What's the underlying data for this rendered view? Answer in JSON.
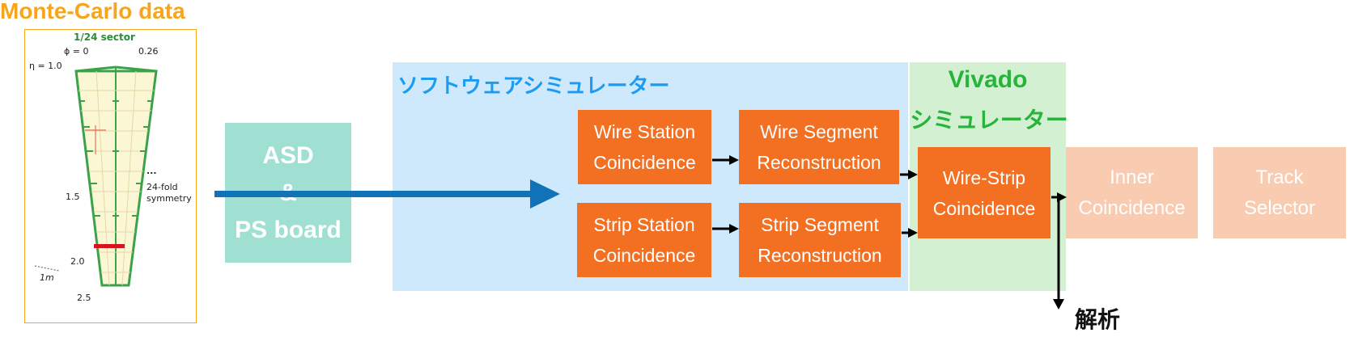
{
  "monte_carlo": {
    "title": "Monte-Carlo data",
    "sector_label": "1/24 sector",
    "phi_label": "ϕ = 0",
    "phi_max": "0.26",
    "eta_top": "η = 1.0",
    "eta_mid": "1.5",
    "eta_low": "2.0",
    "eta_bottom": "2.5",
    "dots": "...",
    "symmetry_line1": "24-fold",
    "symmetry_line2": "symmetry",
    "scale_label": "1m"
  },
  "asd_board": {
    "line1": "ASD",
    "line2": "&",
    "line3": "PS board"
  },
  "software_sim": {
    "label": "ソフトウェアシミュレーター"
  },
  "vivado_sim": {
    "label1": "Vivado",
    "label2": "シミュレーター"
  },
  "blocks": {
    "wire_station": {
      "line1": "Wire Station",
      "line2": "Coincidence"
    },
    "wire_segment": {
      "line1": "Wire Segment",
      "line2": "Reconstruction"
    },
    "strip_station": {
      "line1": "Strip Station",
      "line2": "Coincidence"
    },
    "strip_segment": {
      "line1": "Strip Segment",
      "line2": "Reconstruction"
    },
    "wire_strip": {
      "line1": "Wire-Strip",
      "line2": "Coincidence"
    },
    "inner": {
      "line1": "Inner",
      "line2": "Coincidence"
    },
    "track": {
      "line1": "Track",
      "line2": "Selector"
    }
  },
  "analysis_label": "解析",
  "colors": {
    "orange_block": "#f36f21",
    "faded_block": "#f9cbb0",
    "software_bg": "#cde9fb",
    "software_text": "#1d9bf0",
    "vivado_bg": "#d3f1d2",
    "vivado_text": "#27b43a",
    "asd_bg": "#9fe0d2",
    "mc_title": "#f7a51c",
    "main_arrow": "#1172b8"
  }
}
